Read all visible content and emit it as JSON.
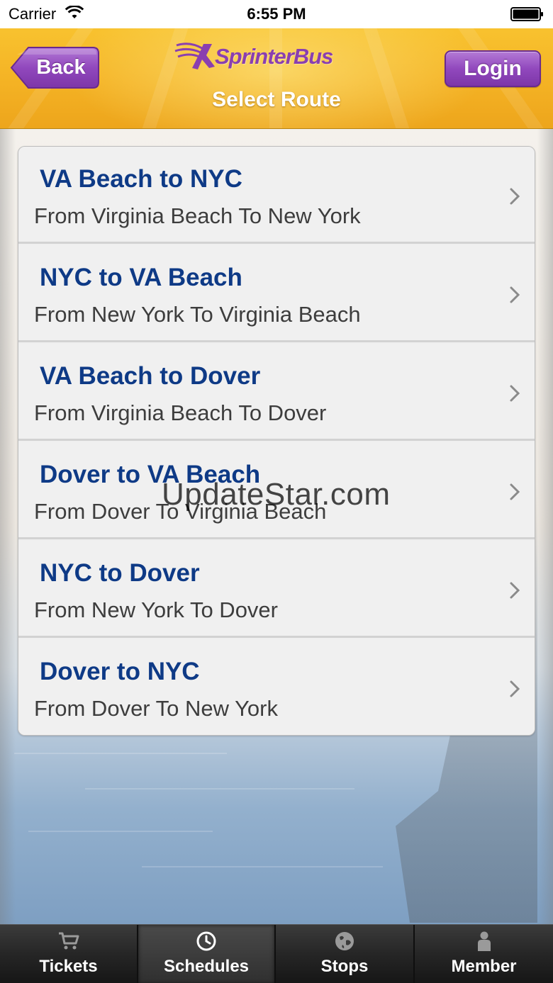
{
  "status_bar": {
    "carrier": "Carrier",
    "time": "6:55 PM"
  },
  "header": {
    "back_label": "Back",
    "logo_text": "SprinterBus",
    "title": "Select Route",
    "login_label": "Login",
    "brand_color": "#8a3fb0",
    "header_color": "#f4b224"
  },
  "routes": [
    {
      "title": "VA Beach to NYC",
      "subtitle": "From Virginia Beach To New York"
    },
    {
      "title": "NYC to VA Beach",
      "subtitle": "From New York To Virginia Beach"
    },
    {
      "title": "VA Beach to Dover",
      "subtitle": "From Virginia Beach To Dover"
    },
    {
      "title": "Dover to VA Beach",
      "subtitle": "From Dover To Virginia Beach"
    },
    {
      "title": "NYC to Dover",
      "subtitle": "From New York To Dover"
    },
    {
      "title": "Dover to NYC",
      "subtitle": "From Dover To New York"
    }
  ],
  "watermark": "UpdateStar.com",
  "tabs": [
    {
      "label": "Tickets",
      "icon": "cart-icon"
    },
    {
      "label": "Schedules",
      "icon": "clock-icon"
    },
    {
      "label": "Stops",
      "icon": "globe-icon"
    },
    {
      "label": "Member",
      "icon": "person-icon"
    }
  ],
  "active_tab": "Schedules",
  "colors": {
    "route_title": "#0e3a86",
    "route_subtitle": "#3d3d3d",
    "button_purple": "#9148bd"
  }
}
